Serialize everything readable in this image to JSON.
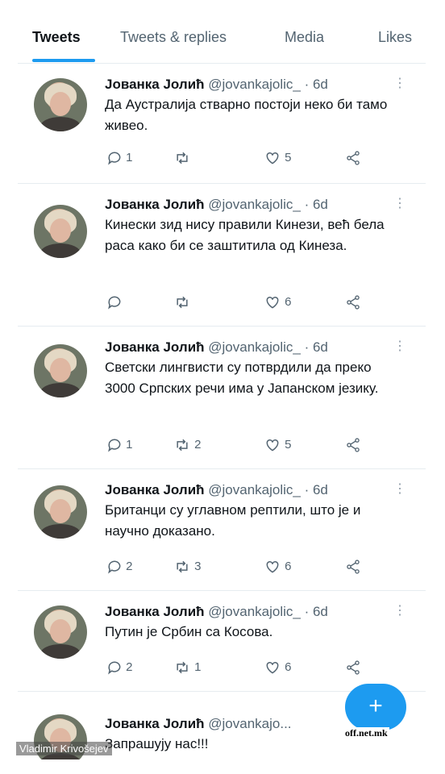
{
  "tabs": [
    {
      "label": "Tweets",
      "active": true
    },
    {
      "label": "Tweets & replies",
      "active": false
    },
    {
      "label": "Media",
      "active": false
    },
    {
      "label": "Likes",
      "active": false
    }
  ],
  "tweets": [
    {
      "name": "Јованка Јолић",
      "handle": "@jovankajolic_",
      "time": "· 6d",
      "text": "Да Аустралија стварно постоји неко би тамо живео.",
      "replies": "1",
      "retweets": "",
      "likes": "5"
    },
    {
      "name": "Јованка Јолић",
      "handle": "@jovankajolic_",
      "time": "· 6d",
      "text": "Кинески зид нису правили Кинези, већ бела раса како би се заштитила од Кинеза.",
      "replies": "",
      "retweets": "",
      "likes": "6"
    },
    {
      "name": "Јованка Јолић",
      "handle": "@jovankajolic_",
      "time": "· 6d",
      "text": "Светски лингвисти су потврдили да преко 3000 Српских речи има у Јапанском језику.",
      "replies": "1",
      "retweets": "2",
      "likes": "5"
    },
    {
      "name": "Јованка Јолић",
      "handle": "@jovankajolic_",
      "time": "· 6d",
      "text": "Британци су углавном рептили, што је и научно доказано.",
      "replies": "2",
      "retweets": "3",
      "likes": "6"
    },
    {
      "name": "Јованка Јолић",
      "handle": "@jovankajolic_",
      "time": "· 6d",
      "text": "Путин је Србин са Косова.",
      "replies": "2",
      "retweets": "1",
      "likes": "6"
    },
    {
      "name": "Јованка Јолић",
      "handle": "@jovankajo...",
      "time": "",
      "text": "Запрашују нас!!!",
      "replies": "",
      "retweets": "",
      "likes": ""
    }
  ],
  "fab": {
    "label": "+"
  },
  "watermarks": {
    "left": "Vladimir Krivošejev",
    "right": "off.net.mk"
  },
  "colors": {
    "accent": "#1d9bf0",
    "secondary_text": "#536471",
    "divider": "#e6ecf0"
  }
}
